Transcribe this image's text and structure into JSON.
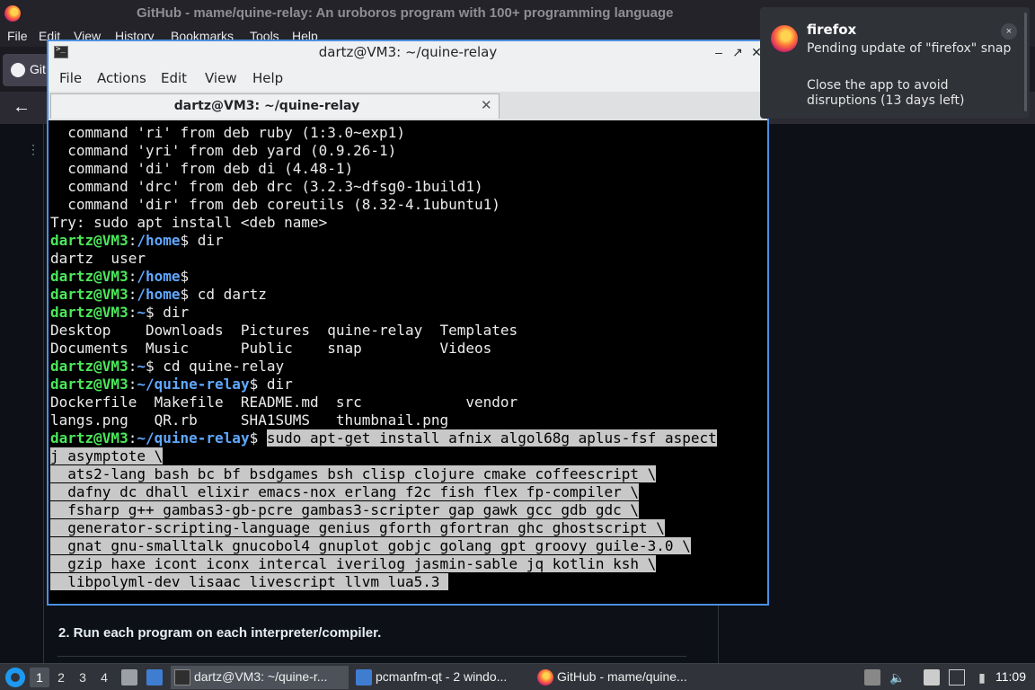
{
  "firefox": {
    "window_title": "GitHub - mame/quine-relay: An uroboros program with 100+ programming language",
    "menu": [
      "File",
      "Edit",
      "View",
      "History",
      "Bookmarks",
      "Tools",
      "Help"
    ],
    "tab_label": "Git",
    "readme_step": "2. Run each program on each interpreter/compiler."
  },
  "terminal": {
    "window_title": "dartz@VM3: ~/quine-relay",
    "menu": [
      "File",
      "Actions",
      "Edit",
      "View",
      "Help"
    ],
    "tab_label": "dartz@VM3: ~/quine-relay",
    "lines": [
      [
        {
          "t": "  command 'ri' from deb ruby (1:3.0~exp1)"
        }
      ],
      [
        {
          "t": "  command 'yri' from deb yard (0.9.26-1)"
        }
      ],
      [
        {
          "t": "  command 'di' from deb di (4.48-1)"
        }
      ],
      [
        {
          "t": "  command 'drc' from deb drc (3.2.3~dfsg0-1build1)"
        }
      ],
      [
        {
          "t": "  command 'dir' from deb coreutils (8.32-4.1ubuntu1)"
        }
      ],
      [
        {
          "t": "Try: sudo apt install <deb name>"
        }
      ],
      [
        {
          "t": "dartz@VM3",
          "c": "pu"
        },
        {
          "t": ":"
        },
        {
          "t": "/home",
          "c": "pd"
        },
        {
          "t": "$ dir"
        }
      ],
      [
        {
          "t": "dartz  user"
        }
      ],
      [
        {
          "t": "dartz@VM3",
          "c": "pu"
        },
        {
          "t": ":"
        },
        {
          "t": "/home",
          "c": "pd"
        },
        {
          "t": "$"
        }
      ],
      [
        {
          "t": "dartz@VM3",
          "c": "pu"
        },
        {
          "t": ":"
        },
        {
          "t": "/home",
          "c": "pd"
        },
        {
          "t": "$ cd dartz"
        }
      ],
      [
        {
          "t": "dartz@VM3",
          "c": "pu"
        },
        {
          "t": ":"
        },
        {
          "t": "~",
          "c": "pd"
        },
        {
          "t": "$ dir"
        }
      ],
      [
        {
          "t": "Desktop    Downloads  Pictures  quine-relay  Templates"
        }
      ],
      [
        {
          "t": "Documents  Music      Public    snap         Videos"
        }
      ],
      [
        {
          "t": "dartz@VM3",
          "c": "pu"
        },
        {
          "t": ":"
        },
        {
          "t": "~",
          "c": "pd"
        },
        {
          "t": "$ cd quine-relay"
        }
      ],
      [
        {
          "t": "dartz@VM3",
          "c": "pu"
        },
        {
          "t": ":"
        },
        {
          "t": "~/quine-relay",
          "c": "pd"
        },
        {
          "t": "$ dir"
        }
      ],
      [
        {
          "t": "Dockerfile  Makefile  README.md  src            vendor"
        }
      ],
      [
        {
          "t": "langs.png   QR.rb     SHA1SUMS   thumbnail.png"
        }
      ],
      [
        {
          "t": "dartz@VM3",
          "c": "pu"
        },
        {
          "t": ":"
        },
        {
          "t": "~/quine-relay",
          "c": "pd"
        },
        {
          "t": "$ "
        },
        {
          "t": "sudo apt-get install afnix algol68g aplus-fsf aspect",
          "c": "sel"
        }
      ],
      [
        {
          "t": "j asymptote \\",
          "c": "sel"
        }
      ],
      [
        {
          "t": "  ats2-lang bash bc bf bsdgames bsh clisp clojure cmake coffeescript \\",
          "c": "sel"
        }
      ],
      [
        {
          "t": "  dafny dc dhall elixir emacs-nox erlang f2c fish flex fp-compiler \\",
          "c": "sel"
        }
      ],
      [
        {
          "t": "  fsharp g++ gambas3-gb-pcre gambas3-scripter gap gawk gcc gdb gdc \\",
          "c": "sel"
        }
      ],
      [
        {
          "t": "  generator-scripting-language genius gforth gfortran ghc ghostscript \\",
          "c": "sel"
        }
      ],
      [
        {
          "t": "  gnat gnu-smalltalk gnucobol4 gnuplot gobjc golang gpt groovy guile-3.0 \\",
          "c": "sel"
        }
      ],
      [
        {
          "t": "  gzip haxe icont iconx intercal iverilog jasmin-sable jq kotlin ksh \\",
          "c": "sel"
        }
      ],
      [
        {
          "t": "  libpolyml-dev lisaac livescript llvm lua5.3 ",
          "c": "sel"
        }
      ]
    ]
  },
  "notification": {
    "app": "firefox",
    "title": "Pending update of \"firefox\" snap",
    "body": "Close the app to avoid disruptions (13 days left)",
    "close_glyph": "×"
  },
  "taskbar": {
    "workspaces": [
      "1",
      "2",
      "3",
      "4"
    ],
    "active_workspace": "1",
    "tasks": [
      {
        "label": "dartz@VM3: ~/quine-r...",
        "icon": "terminal-icon"
      },
      {
        "label": "pcmanfm-qt - 2 windo...",
        "icon": "folder-icon"
      },
      {
        "label": "GitHub - mame/quine...",
        "icon": "firefox-icon"
      }
    ],
    "clock": "11:09"
  }
}
